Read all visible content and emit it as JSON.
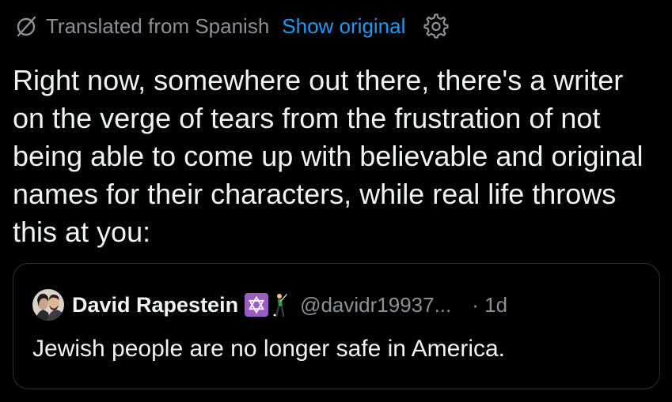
{
  "translation": {
    "label": "Translated from Spanish",
    "show_original": "Show original",
    "icon": "translate-off-icon",
    "settings_icon": "gear-icon"
  },
  "tweet": {
    "text": "Right now, somewhere out there, there's a writer on the verge of tears from the frustration of not being able to come up with believable and original names for their characters, while real life throws this at you:"
  },
  "quoted_tweet": {
    "display_name": "David Rapestein",
    "badges": [
      "star-of-david-icon",
      "golfer-icon"
    ],
    "handle": "@davidr19937...",
    "separator": "·",
    "time": "1d",
    "text": "Jewish people are no longer safe in America."
  },
  "colors": {
    "background": "#000000",
    "accent": "#1d9bf0",
    "muted": "#8b9197",
    "text": "#eff3f4",
    "border": "#2f3336",
    "badge": "#9b5cc6"
  }
}
